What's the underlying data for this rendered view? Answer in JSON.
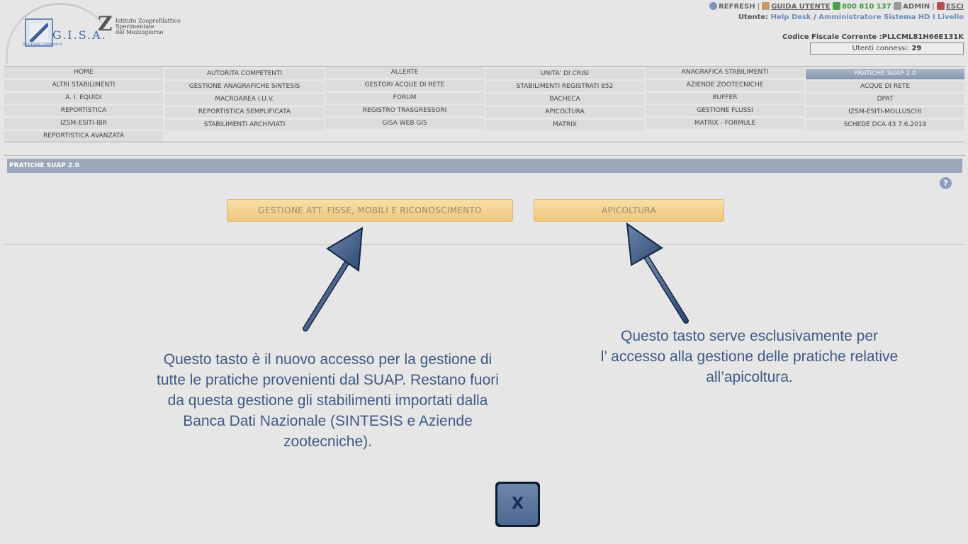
{
  "logo": {
    "gisa": "G.I.S.A.",
    "region": "REGIONE CAMPANIA",
    "izs_line1": "Istituto Zooprofilattico",
    "izs_line2": "Sperimentale",
    "izs_line3": "del Mezzogiorno"
  },
  "toplinks": {
    "refresh": "REFRESH",
    "guide": "GUIDA UTENTE",
    "phone": "800 810 137",
    "admin": "ADMIN",
    "exit": "ESCI",
    "sep": "|"
  },
  "user": {
    "label": "Utente:",
    "name": "Help Desk",
    "slash": "/",
    "role": "Amministratore Sistema HD I Livello"
  },
  "fiscal": {
    "label": "Codice Fiscale Corrente :",
    "value": "PLLCML81H66E131K"
  },
  "connected": {
    "label": "Utenti connessi:",
    "value": "29"
  },
  "menu": {
    "items": [
      "HOME",
      "AUTORITA COMPETENTI",
      "ALLERTE",
      "UNITA' DI CRISI",
      "ANAGRAFICA STABILIMENTI",
      "PRATICHE SUAP 2.0",
      "ALTRI STABILIMENTI",
      "GESTIONE ANAGRAFICHE SINTESIS",
      "GESTORI ACQUE DI RETE",
      "STABILIMENTI REGISTRATI 852",
      "AZIENDE ZOOTECNICHE",
      "ACQUE DI RETE",
      "A. I. EQUIDI",
      "MACROAREA I.U.V.",
      "FORUM",
      "BACHECA",
      "BUFFER",
      "DPAT",
      "REPORTISTICA",
      "REPORTISTICA SEMPLIFICATA",
      "REGISTRO TRASGRESSORI",
      "APICOLTURA",
      "GESTIONE FLUSSI",
      "IZSM-ESITI-MOLLUSCHI",
      "IZSM-ESITI-IBR",
      "STABILIMENTI ARCHIVIATI",
      "GISA WEB GIS",
      "MATRIX",
      "MATRIX - FORMULE",
      "SCHEDE DCA 43 7.6.2019",
      "REPORTISTICA AVANZATA"
    ],
    "active": "PRATICHE SUAP 2.0"
  },
  "section": {
    "title": "PRATICHE SUAP 2.0",
    "help": "?"
  },
  "buttons": {
    "gestione": "GESTIONE ATT. FISSE, MOBILI E RICONOSCIMENTO",
    "apicoltura": "APICOLTURA"
  },
  "annotations": {
    "left": [
      "Questo tasto è il nuovo accesso per la gestione di",
      "tutte le pratiche provenienti dal SUAP. Restano fuori",
      "da questa gestione gli stabilimenti importati dalla",
      "Banca Dati Nazionale (SINTESIS e Aziende",
      "zootecniche)."
    ],
    "right": [
      "Questo tasto serve esclusivamente per",
      "l’ accesso alla gestione delle pratiche relative",
      "all’apicoltura."
    ]
  },
  "close": {
    "label": "X"
  },
  "colors": {
    "accent": "#3e5a86",
    "button": "#efc77f",
    "section": "#9aa8ba",
    "active_menu": "#8597b0"
  }
}
